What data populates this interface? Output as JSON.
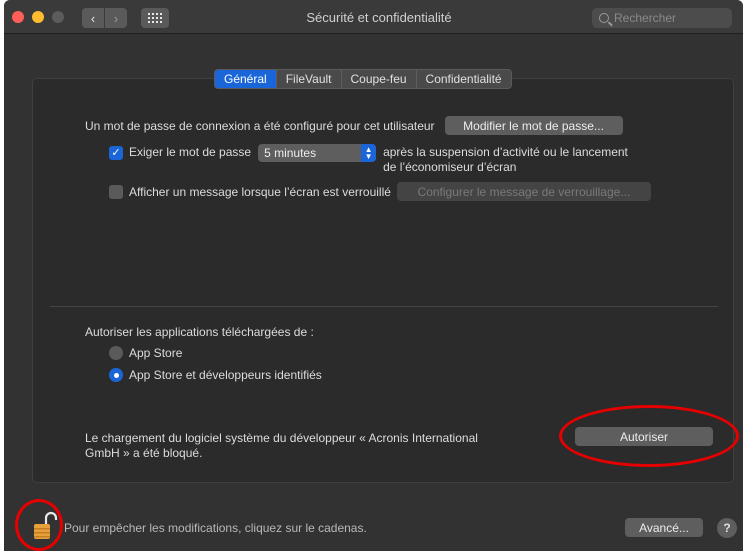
{
  "window": {
    "title": "Sécurité et confidentialité",
    "search_placeholder": "Rechercher"
  },
  "tabs": [
    {
      "label": "Général",
      "active": true
    },
    {
      "label": "FileVault",
      "active": false
    },
    {
      "label": "Coupe-feu",
      "active": false
    },
    {
      "label": "Confidentialité",
      "active": false
    }
  ],
  "general": {
    "password_text": "Un mot de passe de connexion a été configuré pour cet utilisateur",
    "change_password_button": "Modifier le mot de passe...",
    "require_password_label": "Exiger le mot de passe",
    "require_password_checked": true,
    "delay_value": "5 minutes",
    "after_text_line1": "après la suspension d’activité ou le lancement",
    "after_text_line2": "de l’économiseur d’écran",
    "show_message_label": "Afficher un message lorsque l’écran est verrouillé",
    "show_message_checked": false,
    "configure_message_button": "Configurer le message de verrouillage..."
  },
  "downloads": {
    "heading": "Autoriser les applications téléchargées de :",
    "options": [
      {
        "label": "App Store",
        "selected": false
      },
      {
        "label": "App Store et développeurs identifiés",
        "selected": true
      }
    ]
  },
  "blocked": {
    "line1": "Le chargement du logiciel système du développeur « Acronis International",
    "line2": "GmbH » a été bloqué.",
    "allow_button": "Autoriser"
  },
  "footer": {
    "lock_text": "Pour empêcher les modifications, cliquez sur le cadenas.",
    "advanced_button": "Avancé...",
    "help_button": "?"
  },
  "colors": {
    "accent": "#1a66d9",
    "annotation": "#e60000",
    "lock": "#e8a03a"
  },
  "icons": {
    "back": "chevron-left-icon",
    "forward": "chevron-right-icon",
    "grid": "grid-icon",
    "search": "search-icon",
    "lock": "unlocked-padlock-icon"
  }
}
